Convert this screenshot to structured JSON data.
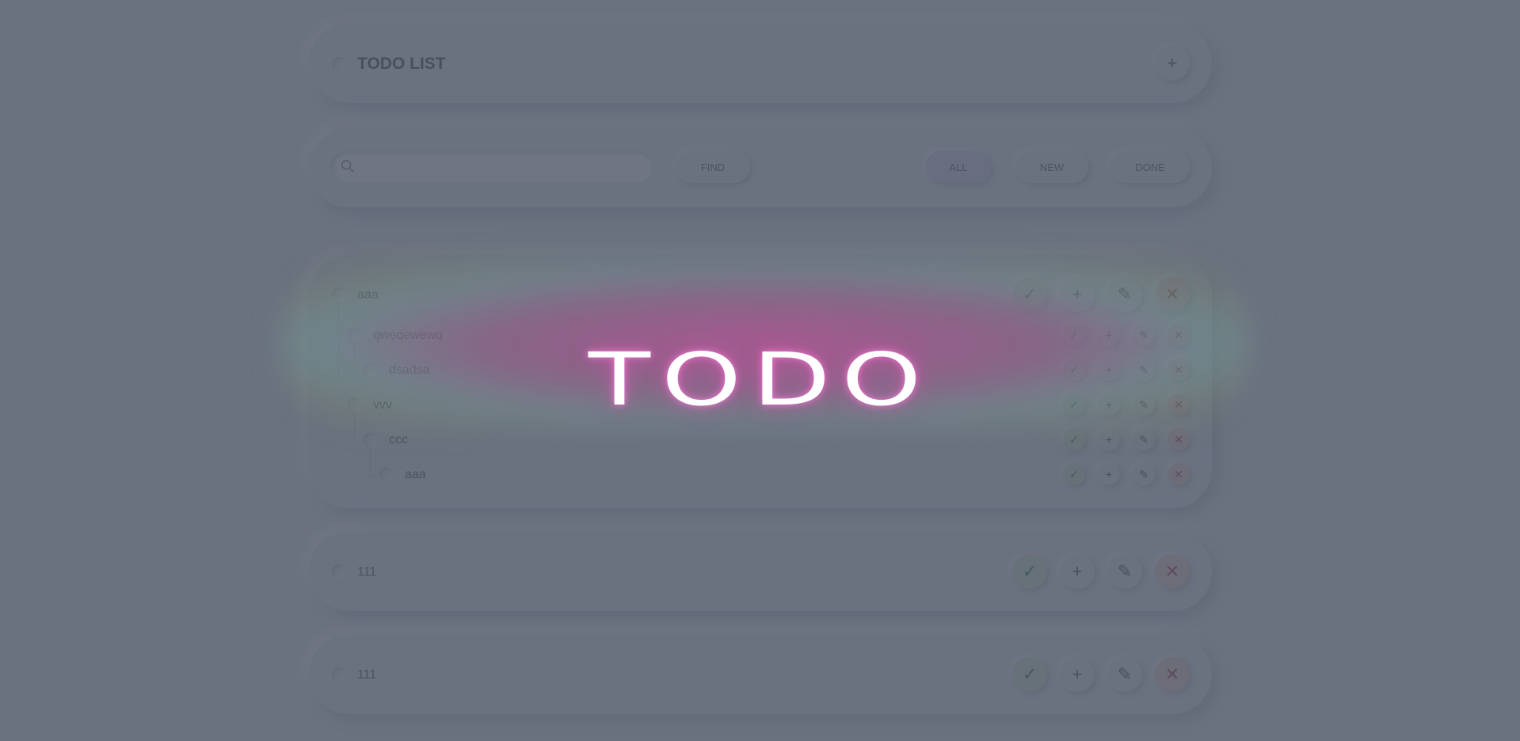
{
  "header": {
    "title": "TODO LIST",
    "add_label": "+"
  },
  "filter": {
    "search_placeholder": "",
    "find_label": "FIND",
    "all_label": "ALL",
    "new_label": "NEW",
    "done_label": "DONE"
  },
  "actions": {
    "done": "✓",
    "add": "+",
    "edit": "✎",
    "delete": "✕"
  },
  "groups": [
    {
      "items": [
        {
          "label": "aaa",
          "level": 0
        },
        {
          "label": "qweqewewq",
          "level": 1
        },
        {
          "label": "dsadsa",
          "level": 2
        },
        {
          "label": "vvv",
          "level": 1
        },
        {
          "label": "ccc",
          "level": 2
        },
        {
          "label": "aaa",
          "level": 3
        }
      ]
    },
    {
      "items": [
        {
          "label": "111",
          "level": 0
        }
      ]
    },
    {
      "items": [
        {
          "label": "111",
          "level": 0
        }
      ]
    }
  ],
  "overlay": {
    "logo_text": "TODO"
  },
  "colors": {
    "background": "#e9ecef",
    "done": "#3b8a3b",
    "delete": "#b54444",
    "active_filter": "#e3d9f4",
    "overlay": "#464e5f"
  }
}
